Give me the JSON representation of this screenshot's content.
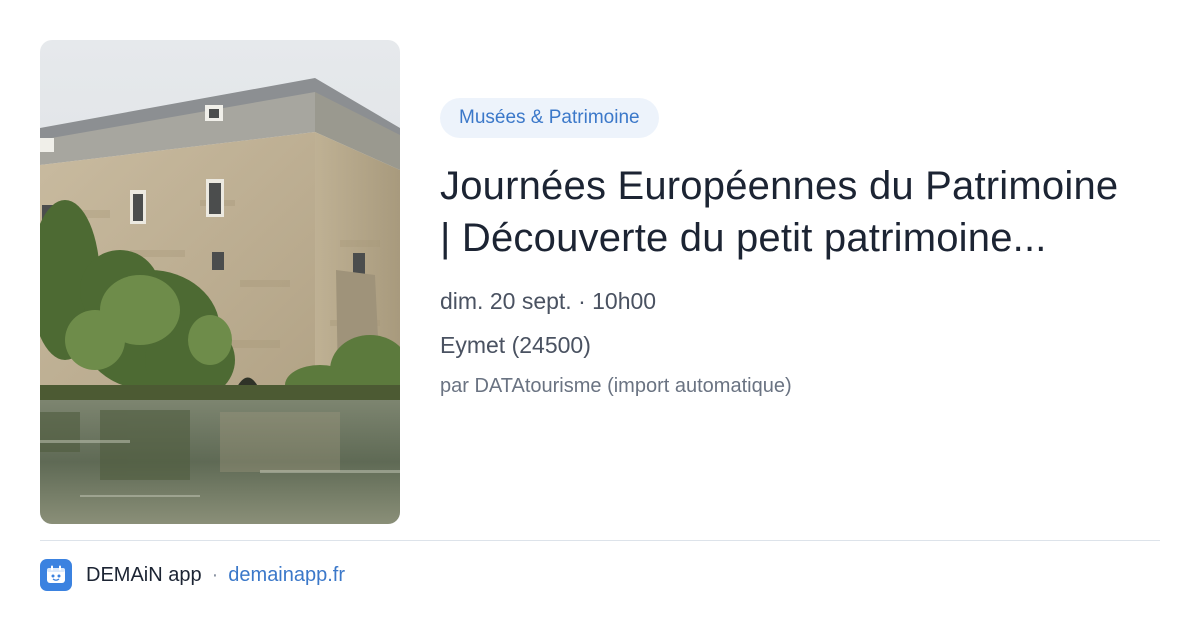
{
  "card": {
    "image_alt": "Old stone mill building by the water",
    "category": "Musées & Patrimoine",
    "title": "Journées Européennes du Patrimoine | Découverte du petit patrimoine...",
    "datetime": "dim. 20 sept. · 10h00",
    "location": "Eymet (24500)",
    "source": "par DATAtourisme (import automatique)"
  },
  "footer": {
    "app_name": "DEMAiN app",
    "separator": "·",
    "link_text": "demainapp.fr"
  },
  "colors": {
    "accent": "#3b78c9",
    "badge_bg": "#edf3fb",
    "title": "#1c2433",
    "meta": "#4a5261",
    "app_icon_bg": "#3b82e0"
  }
}
